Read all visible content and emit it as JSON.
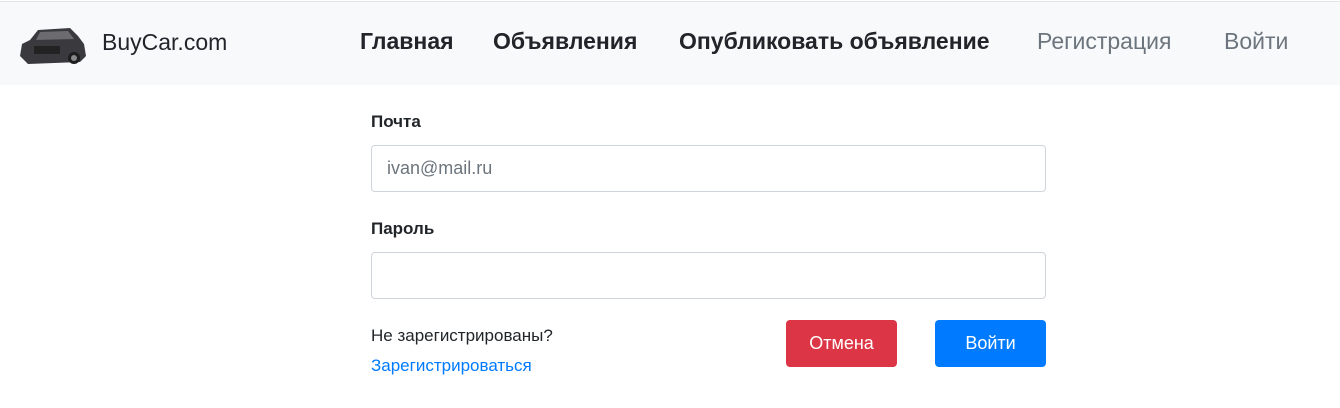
{
  "header": {
    "brand": "BuyCar.com",
    "nav": [
      {
        "label": "Главная"
      },
      {
        "label": "Объявления"
      },
      {
        "label": "Опубликовать объявление"
      },
      {
        "label": "Регистрация"
      },
      {
        "label": "Войти"
      }
    ]
  },
  "form": {
    "email_label": "Почта",
    "email_placeholder": "ivan@mail.ru",
    "email_value": "",
    "password_label": "Пароль",
    "password_value": "",
    "not_registered": "Не зарегистрированы?",
    "register_link": "Зарегистрироваться",
    "cancel_label": "Отмена",
    "login_label": "Войти"
  },
  "colors": {
    "cancel": "#dc3545",
    "primary": "#007bff",
    "link": "#007bff"
  }
}
